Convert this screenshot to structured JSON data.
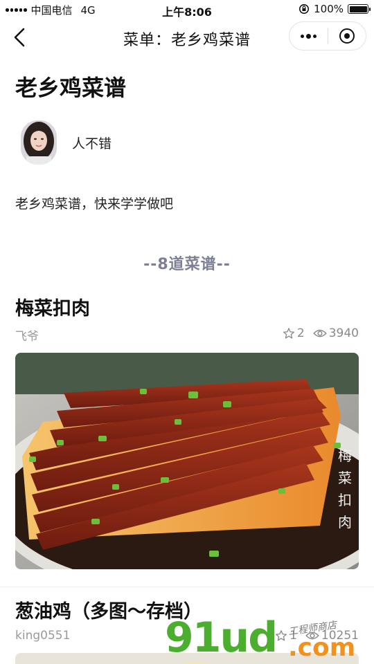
{
  "status_bar": {
    "carrier": "中国电信",
    "network": "4G",
    "time": "上午8:06",
    "battery_percent": "100%",
    "battery_level": 1.0
  },
  "nav": {
    "title": "菜单：老乡鸡菜谱",
    "back_icon": "chevron-left-icon",
    "more_icon": "more-dots-icon",
    "close_icon": "target-close-icon"
  },
  "menu": {
    "title": "老乡鸡菜谱",
    "author": "人不错",
    "description": "老乡鸡菜谱，快来学学做吧",
    "count_label": "--8道菜谱--"
  },
  "recipes": [
    {
      "title": "梅菜扣肉",
      "author": "飞爷",
      "stars": "2",
      "views": "3940",
      "image_caption_chars": "梅菜扣肉"
    },
    {
      "title": "葱油鸡（多图～存档）",
      "author": "king0551",
      "stars": "1",
      "views": "10251"
    }
  ],
  "watermark": {
    "main": "91ud",
    "com": ".com",
    "small": "工程师商店"
  },
  "colors": {
    "accent_divider": "#7d7f96",
    "meta_grey": "#9a9a9a",
    "watermark_green": "#4cae2f",
    "watermark_orange": "#f2911b"
  }
}
